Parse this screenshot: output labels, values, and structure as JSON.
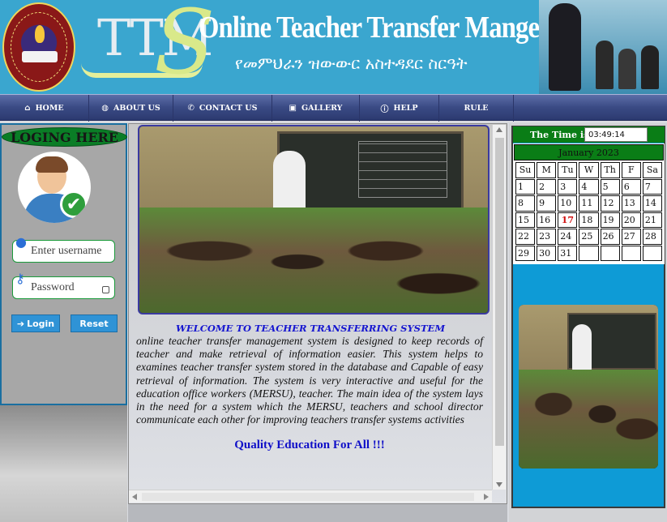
{
  "header": {
    "logo_text": "",
    "brand_letters": "TTM",
    "brand_s": "S",
    "title_en": "Online Teacher Transfer Mangement System",
    "title_am": "የመምህራን ዝውውር አስተዳደር ስርዓት"
  },
  "nav": {
    "items": [
      {
        "label": "HOME",
        "icon": "home-icon"
      },
      {
        "label": "ABOUT US",
        "icon": "globe-icon"
      },
      {
        "label": "CONTACT US",
        "icon": "phone-icon"
      },
      {
        "label": "GALLERY",
        "icon": "image-icon"
      },
      {
        "label": "HELP",
        "icon": "info-icon"
      },
      {
        "label": "RULE",
        "icon": ""
      }
    ]
  },
  "login": {
    "heading": "LOGING HERE",
    "username_placeholder": "Enter username",
    "password_placeholder": "Password",
    "login_label": "Login",
    "reset_label": "Reset"
  },
  "main": {
    "welcome": "WELCOME TO TEACHER TRANSFERRING SYSTEM",
    "description": "online teacher transfer management system is designed to keep records of teacher and make retrieval of information easier. This system helps to examines teacher transfer system stored in the database and Capable of easy retrieval of information. The system is very interactive and useful for the education office workers (MERSU), teacher. The main idea of the system lays in the need for a system which the MERSU, teachers and school director communicate each other for improving teachers transfer systems activities",
    "slogan": "Quality Education For All !!!"
  },
  "sidebar": {
    "time_label": "The Time is:",
    "time_value": "03:49:14",
    "calendar": {
      "month_title": "January 2023",
      "weekdays": [
        "Su",
        "M",
        "Tu",
        "W",
        "Th",
        "F",
        "Sa"
      ],
      "weeks": [
        [
          "1",
          "2",
          "3",
          "4",
          "5",
          "6",
          "7"
        ],
        [
          "8",
          "9",
          "10",
          "11",
          "12",
          "13",
          "14"
        ],
        [
          "15",
          "16",
          "17",
          "18",
          "19",
          "20",
          "21"
        ],
        [
          "22",
          "23",
          "24",
          "25",
          "26",
          "27",
          "28"
        ],
        [
          "29",
          "30",
          "31",
          "",
          "",
          "",
          ""
        ]
      ],
      "today": "17"
    }
  },
  "colors": {
    "banner": "#3aa6cf",
    "nav": "#3a4a84",
    "accent_green": "#0a7d16",
    "link_blue": "#1616d0",
    "sidebar_blue": "#0e9bd6",
    "today_red": "#d01010"
  }
}
